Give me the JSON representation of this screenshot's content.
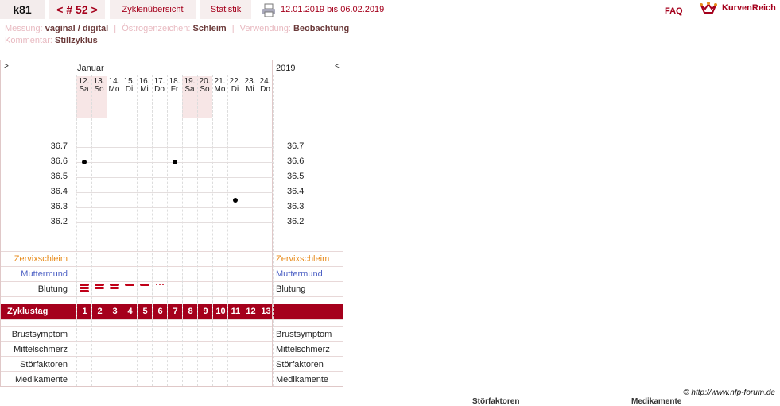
{
  "topbar": {
    "user": "k81",
    "nav": {
      "prev": "<",
      "label": "# 52",
      "next": ">"
    },
    "tabs": [
      "Zyklenübersicht",
      "Statistik"
    ],
    "date_range": "12.01.2019 bis 06.02.2019",
    "faq": "FAQ",
    "logo": "KurvenReich"
  },
  "info": {
    "messung_label": "Messung:",
    "messung_value": "vaginal / digital",
    "oestrogen_label": "Östrogenzeichen:",
    "oestrogen_value": "Schleim",
    "verwendung_label": "Verwendung:",
    "verwendung_value": "Beobachtung",
    "kommentar_label": "Kommentar:",
    "kommentar_value": "Stillzyklus"
  },
  "chart": {
    "nav_left": ">",
    "nav_right": "<",
    "month": "Januar",
    "year": "2019",
    "days": [
      {
        "d": "12.",
        "w": "Sa"
      },
      {
        "d": "13.",
        "w": "So"
      },
      {
        "d": "14.",
        "w": "Mo"
      },
      {
        "d": "15.",
        "w": "Di"
      },
      {
        "d": "16.",
        "w": "Mi"
      },
      {
        "d": "17.",
        "w": "Do"
      },
      {
        "d": "18.",
        "w": "Fr"
      },
      {
        "d": "19.",
        "w": "Sa"
      },
      {
        "d": "20.",
        "w": "So"
      },
      {
        "d": "21.",
        "w": "Mo"
      },
      {
        "d": "22.",
        "w": "Di"
      },
      {
        "d": "23.",
        "w": "Mi"
      },
      {
        "d": "24.",
        "w": "Do"
      }
    ],
    "temp_ticks": [
      "36.7",
      "36.6",
      "36.5",
      "36.4",
      "36.3",
      "36.2"
    ],
    "temps": [
      {
        "day": 1,
        "value": 36.6
      },
      {
        "day": 7,
        "value": 36.6
      },
      {
        "day": 11,
        "value": 36.35
      }
    ],
    "bleeding": [
      "heavy",
      "medium",
      "medium",
      "light",
      "light",
      "spotting"
    ],
    "rows": {
      "zervix": "Zervixschleim",
      "muttermund": "Muttermund",
      "blutung": "Blutung",
      "zyklustag": "Zyklustag",
      "brust": "Brustsymptom",
      "mittel": "Mittelschmerz",
      "stoer": "Störfaktoren",
      "medi": "Medikamente"
    },
    "cycle_days": [
      "1",
      "2",
      "3",
      "4",
      "5",
      "6",
      "7",
      "8",
      "9",
      "10",
      "11",
      "12",
      "13"
    ],
    "colors": {
      "zervix": "#e88a1a",
      "muttermund": "#4b5fc4",
      "accent": "#a5001c"
    }
  },
  "footer": {
    "copyright": "© http://www.nfp-forum.de",
    "cut1": "Störfaktoren",
    "cut2": "Medikamente"
  }
}
